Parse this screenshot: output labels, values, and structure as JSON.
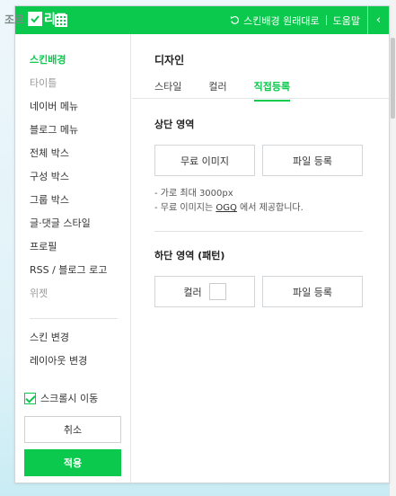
{
  "topbar": {
    "logo_partial": "조르",
    "title": "리모",
    "reset_label": "스킨배경 원래대로",
    "help_label": "도움말",
    "collapse_glyph": "‹"
  },
  "sidebar": {
    "items": [
      {
        "label": "스킨배경"
      },
      {
        "label": "타이틀"
      },
      {
        "label": "네이버 메뉴"
      },
      {
        "label": "블로그 메뉴"
      },
      {
        "label": "전체 박스"
      },
      {
        "label": "구성 박스"
      },
      {
        "label": "그룹 박스"
      },
      {
        "label": "글·댓글 스타일"
      },
      {
        "label": "프로필"
      },
      {
        "label": "RSS / 블로그 로고"
      },
      {
        "label": "위젯"
      }
    ],
    "items2": [
      {
        "label": "스킨 변경"
      },
      {
        "label": "레이아웃 변경"
      }
    ],
    "scroll_toggle_label": "스크롤시 이동",
    "cancel_label": "취소",
    "apply_label": "적용"
  },
  "main": {
    "section_title": "디자인",
    "tabs": [
      {
        "label": "스타일"
      },
      {
        "label": "컬러"
      },
      {
        "label": "직접등록"
      }
    ],
    "upper": {
      "title": "상단 영역",
      "free_image_label": "무료 이미지",
      "file_upload_label": "파일 등록",
      "note1": "- 가로 최대 3000px",
      "note2_prefix": "- 무료 이미지는 ",
      "note2_link": "OGQ",
      "note2_suffix": " 에서 제공합니다."
    },
    "lower": {
      "title": "하단 영역 (패턴)",
      "color_label": "컬러",
      "file_upload_label": "파일 등록"
    }
  },
  "colors": {
    "accent": "#0ac94c"
  }
}
